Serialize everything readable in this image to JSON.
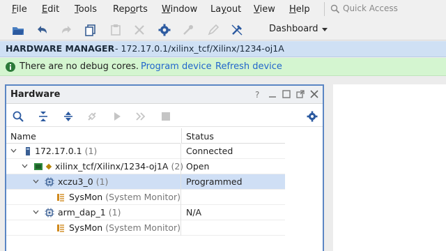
{
  "menubar": {
    "items": [
      {
        "pre": "",
        "u": "F",
        "post": "ile"
      },
      {
        "pre": "",
        "u": "E",
        "post": "dit"
      },
      {
        "pre": "",
        "u": "T",
        "post": "ools"
      },
      {
        "pre": "Rep",
        "u": "o",
        "post": "rts"
      },
      {
        "pre": "",
        "u": "W",
        "post": "indow"
      },
      {
        "pre": "La",
        "u": "y",
        "post": "out"
      },
      {
        "pre": "",
        "u": "V",
        "post": "iew"
      },
      {
        "pre": "",
        "u": "H",
        "post": "elp"
      }
    ],
    "quick_access_placeholder": "Quick Access"
  },
  "toolbar": {
    "dashboard_label": "Dashboard"
  },
  "hardware_manager": {
    "title": "HARDWARE MANAGER",
    "path": "- 172.17.0.1/xilinx_tcf/Xilinx/1234-oj1A"
  },
  "banner": {
    "message": "There are no debug cores.",
    "program_link": "Program device",
    "refresh_link": "Refresh device",
    "color_bg": "#d4f5d0",
    "color_link": "#2266cc"
  },
  "hardware_panel": {
    "title": "Hardware",
    "columns": {
      "name": "Name",
      "status": "Status"
    },
    "rows": [
      {
        "name": "172.17.0.1",
        "count": "(1)",
        "status": "Connected",
        "icon": "server-icon"
      },
      {
        "name": "xilinx_tcf/Xilinx/1234-oj1A",
        "count": "(2)",
        "status": "Open",
        "icon": "target-board-icon"
      },
      {
        "name": "xczu3_0",
        "count": "(1)",
        "status": "Programmed",
        "icon": "fpga-chip-icon"
      },
      {
        "name": "SysMon",
        "count": "(System Monitor)",
        "status": "",
        "icon": "sysmon-icon"
      },
      {
        "name": "arm_dap_1",
        "count": "(1)",
        "status": "N/A",
        "icon": "fpga-chip-icon"
      },
      {
        "name": "SysMon",
        "count": "(System Monitor)",
        "status": "",
        "icon": "sysmon-icon"
      }
    ]
  },
  "colors": {
    "header_bg": "#cfe0f4",
    "selection": "#cfdff5",
    "panel_border": "#5b86c4"
  }
}
